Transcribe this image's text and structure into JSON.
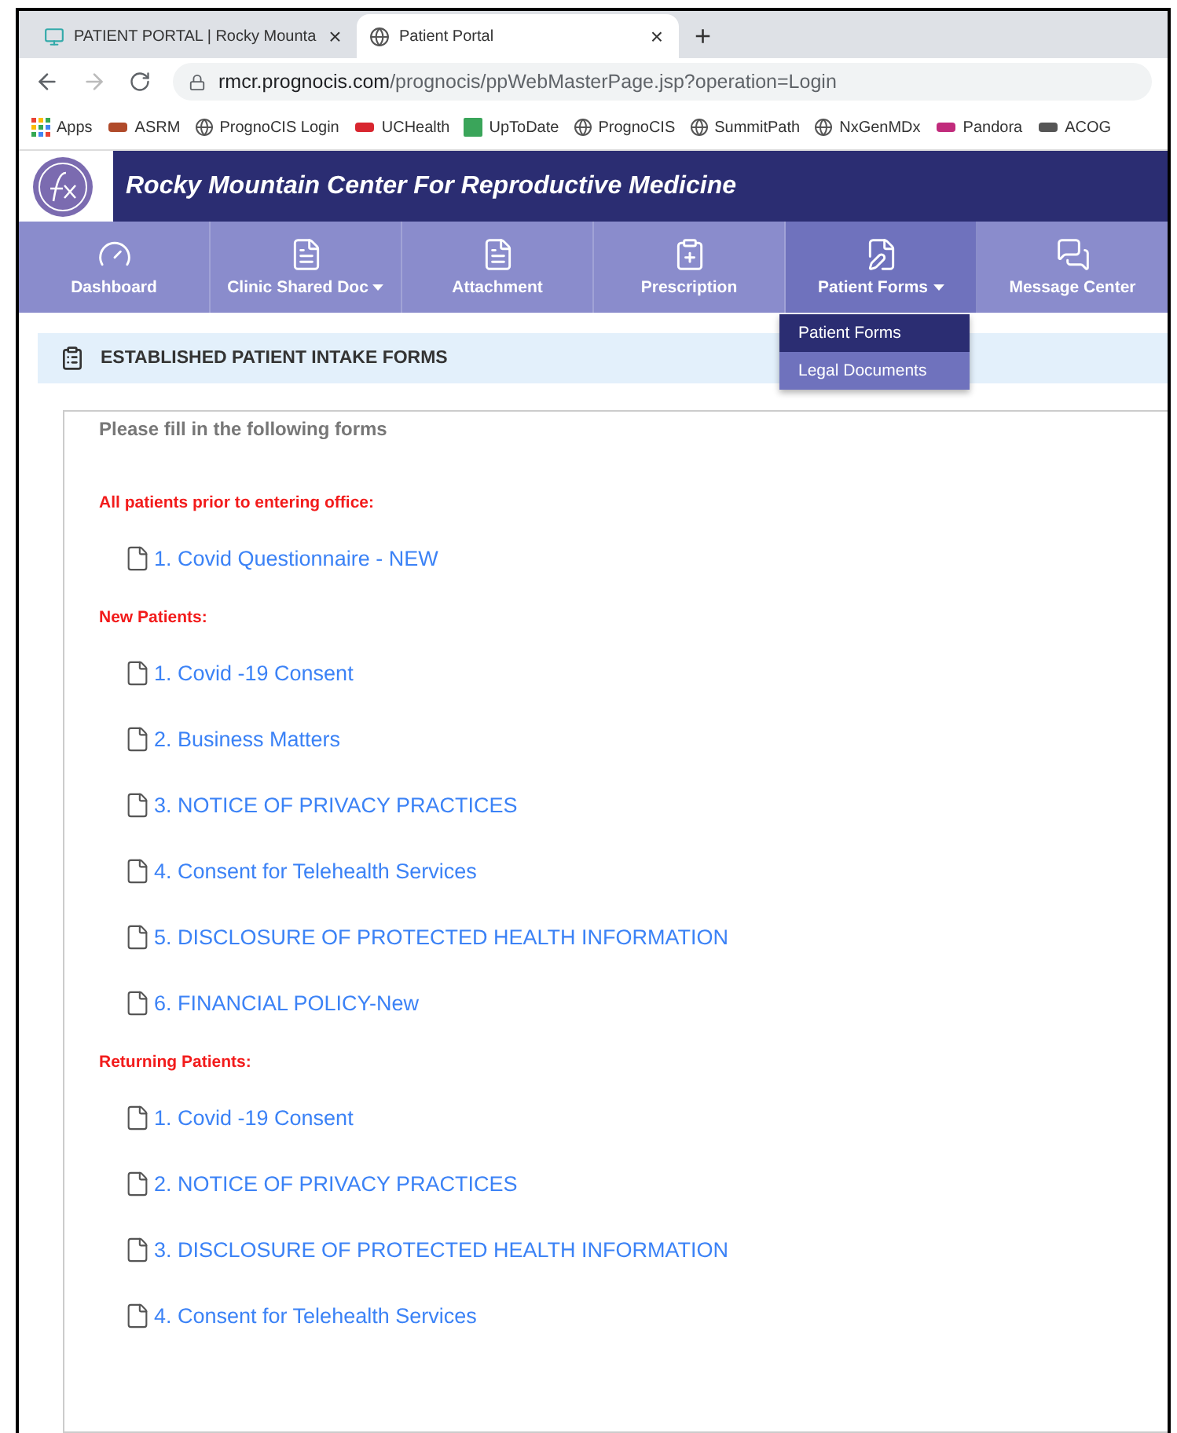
{
  "browser": {
    "tabs": [
      {
        "title": "PATIENT PORTAL | Rocky Mounta",
        "selected": false,
        "kind": "portal"
      },
      {
        "title": "Patient Portal",
        "selected": true,
        "kind": "globe"
      }
    ],
    "new_tab": "+",
    "close": "×",
    "address": {
      "host": "rmcr.prognocis.com",
      "path": "/prognocis/ppWebMasterPage.jsp?operation=Login"
    },
    "bookmarks": [
      {
        "label": "Apps",
        "kind": "apps"
      },
      {
        "label": "ASRM",
        "kind": "brand",
        "color": "#b04a2a"
      },
      {
        "label": "PrognoCIS Login",
        "kind": "globe"
      },
      {
        "label": "UCHealth",
        "kind": "brand",
        "color": "#d8262f"
      },
      {
        "label": "UpToDate",
        "kind": "square",
        "color": "#3aa55a"
      },
      {
        "label": "PrognoCIS",
        "kind": "globe"
      },
      {
        "label": "SummitPath",
        "kind": "globe"
      },
      {
        "label": "NxGenMDx",
        "kind": "globe"
      },
      {
        "label": "Pandora",
        "kind": "brand",
        "color": "#c12b7c"
      },
      {
        "label": "ACOG",
        "kind": "brand",
        "color": "#555555"
      }
    ]
  },
  "header": {
    "title": "Rocky Mountain Center For Reproductive Medicine"
  },
  "nav": [
    {
      "label": "Dashboard",
      "kind": "gauge",
      "caret": false,
      "selected": false
    },
    {
      "label": "Clinic Shared Doc",
      "kind": "doc",
      "caret": true,
      "selected": false
    },
    {
      "label": "Attachment",
      "kind": "doc",
      "caret": false,
      "selected": false
    },
    {
      "label": "Prescription",
      "kind": "rx",
      "caret": false,
      "selected": false
    },
    {
      "label": "Patient Forms",
      "kind": "edit",
      "caret": true,
      "selected": true
    },
    {
      "label": "Message Center",
      "kind": "chat",
      "caret": false,
      "selected": false
    }
  ],
  "dropdown": [
    {
      "label": "Patient Forms",
      "selected": true
    },
    {
      "label": "Legal Documents",
      "selected": false
    }
  ],
  "panel": {
    "title": "ESTABLISHED PATIENT INTAKE FORMS",
    "intro": "Please fill in the following forms",
    "sections": [
      {
        "heading": "All patients prior to entering office:",
        "forms": [
          "1. Covid Questionnaire - NEW"
        ]
      },
      {
        "heading": "New Patients:",
        "forms": [
          "1. Covid -19 Consent",
          "2. Business Matters",
          "3. NOTICE OF PRIVACY PRACTICES",
          "4. Consent for Telehealth Services",
          "5. DISCLOSURE OF PROTECTED HEALTH INFORMATION",
          "6. FINANCIAL POLICY-New"
        ]
      },
      {
        "heading": "Returning Patients:",
        "forms": [
          "1. Covid -19 Consent",
          "2. NOTICE OF PRIVACY PRACTICES",
          "3. DISCLOSURE OF PROTECTED HEALTH INFORMATION",
          "4. Consent for Telehealth Services"
        ]
      }
    ]
  }
}
